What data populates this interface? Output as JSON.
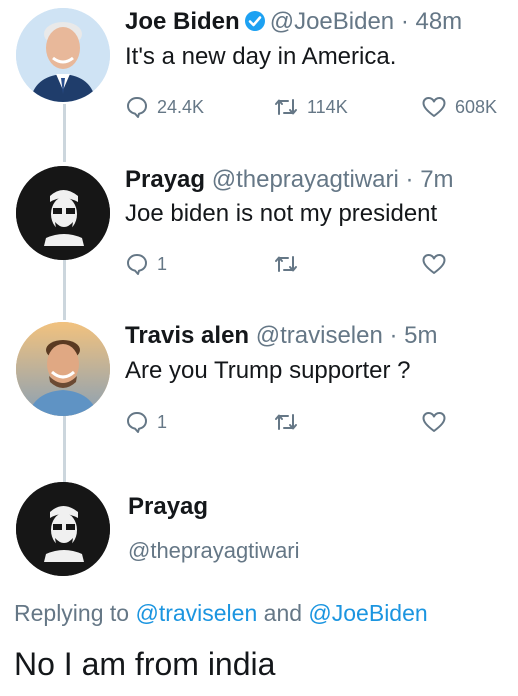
{
  "tweets": [
    {
      "name": "Joe Biden",
      "handle": "@JoeBiden",
      "time": "48m",
      "text": "It's a new day in America.",
      "replies": "24.4K",
      "retweets": "114K",
      "likes": "608K"
    },
    {
      "name": "Prayag",
      "handle": "@theprayagtiwari",
      "time": "7m",
      "text": "Joe biden is not my president",
      "replies": "1"
    },
    {
      "name": "Travis alen",
      "handle": "@traviselen",
      "time": "5m",
      "text": "Are you Trump supporter ?",
      "replies": "1"
    }
  ],
  "detail": {
    "name": "Prayag",
    "handle": "@theprayagtiwari",
    "replying_prefix": "Replying to ",
    "reply_to_1": "@traviselen",
    "replying_and": " and ",
    "reply_to_2": "@JoeBiden",
    "text": "No I am from india"
  },
  "colors": {
    "text": "#14171a",
    "secondary": "#657786",
    "link": "#1b95e0",
    "verified": "#1da1f2",
    "thread_line": "#ccd6dd"
  },
  "icons": [
    "verified-badge-icon",
    "reply-icon",
    "retweet-icon",
    "like-icon"
  ]
}
